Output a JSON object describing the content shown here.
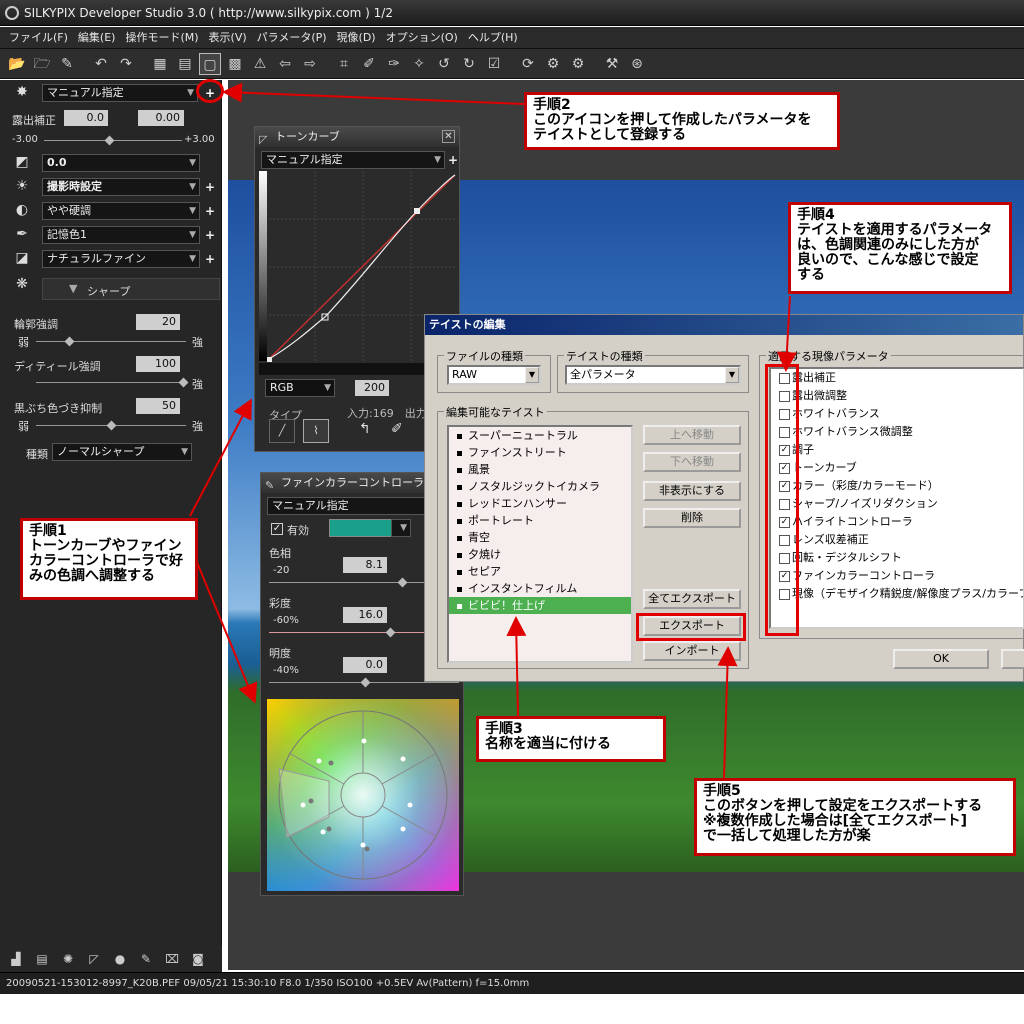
{
  "window": {
    "title": "SILKYPIX Developer Studio 3.0 ( http://www.silkypix.com )  1/2"
  },
  "menu": [
    "ファイル(F)",
    "編集(E)",
    "操作モード(M)",
    "表示(V)",
    "パラメータ(P)",
    "現像(D)",
    "オプション(O)",
    "ヘルプ(H)"
  ],
  "left": {
    "taste_select": "マニュアル指定",
    "exposure_label": "露出補正",
    "exposure_value": "0.0",
    "exposure_value2": "0.00",
    "exposure_min": "-3.00",
    "exposure_max": "+3.00",
    "wb_value": "0.0",
    "wb_mode": "撮影時設定",
    "contrast": "やや硬調",
    "color": "記憶色1",
    "finish": "ナチュラルファイン",
    "sharp_title": "シャープ",
    "sharp_rows": [
      {
        "label": "輪郭強調",
        "value": "20"
      },
      {
        "label": "ディティール強調",
        "value": "100"
      },
      {
        "label": "黒ぶち色づき抑制",
        "value": "50"
      }
    ],
    "weak": "弱",
    "strong": "強",
    "type_label": "種類",
    "type_value": "ノーマルシャープ"
  },
  "tone": {
    "title": "トーンカーブ",
    "mode": "マニュアル指定",
    "channel": "RGB",
    "input_value": "200",
    "type_label": "タイプ",
    "io_text": "入力:169　出力"
  },
  "fcc": {
    "title": "ファインカラーコントローラ",
    "mode": "マニュアル指定",
    "enabled": "有効",
    "hue_label": "色相",
    "hue_min": "-20",
    "hue_value": "8.1",
    "sat_label": "彩度",
    "sat_min": "-60%",
    "sat_value": "16.0",
    "bri_label": "明度",
    "bri_min": "-40%",
    "bri_value": "0.0"
  },
  "dialog": {
    "title": "テイストの編集",
    "file_type_label": "ファイルの種類",
    "file_type": "RAW",
    "taste_type_label": "テイストの種類",
    "taste_type": "全パラメータ",
    "editable_label": "編集可能なテイスト",
    "tastes": [
      "スーパーニュートラル",
      "ファインストリート",
      "風景",
      "ノスタルジックトイカメラ",
      "レッドエンハンサー",
      "ポートレート",
      "青空",
      "夕焼け",
      "セピア",
      "インスタントフィルム",
      "ビビビ！仕上げ"
    ],
    "btn_up": "上へ移動",
    "btn_down": "下へ移動",
    "btn_hide": "非表示にする",
    "btn_delete": "削除",
    "btn_export_all": "全てエクスポート",
    "btn_export": "エクスポート",
    "btn_import": "インポート",
    "params_label": "適用する現像パラメータ",
    "params": [
      {
        "label": "露出補正",
        "checked": false
      },
      {
        "label": "露出微調整",
        "checked": false
      },
      {
        "label": "ホワイトバランス",
        "checked": false
      },
      {
        "label": "ホワイトバランス微調整",
        "checked": false
      },
      {
        "label": "調子",
        "checked": true
      },
      {
        "label": "トーンカーブ",
        "checked": true
      },
      {
        "label": "カラー（彩度/カラーモード）",
        "checked": true
      },
      {
        "label": "シャープ/ノイズリダクション",
        "checked": false
      },
      {
        "label": "ハイライトコントローラ",
        "checked": true
      },
      {
        "label": "レンズ収差補正",
        "checked": false
      },
      {
        "label": "回転・デジタルシフト",
        "checked": false
      },
      {
        "label": "ファインカラーコントローラ",
        "checked": true
      },
      {
        "label": "現像（デモザイク精鋭度/解像度プラス/カラーフ",
        "checked": false
      }
    ],
    "ok": "OK"
  },
  "callouts": {
    "step1": "手順1\nトーンカーブやファイン\nカラーコントローラで好\nみの色調へ調整する",
    "step2": "手順2\nこのアイコンを押して作成したパラメータを\nテイストとして登録する",
    "step3": "手順3\n名称を適当に付ける",
    "step4": "手順4\nテイストを適用するパラメータ\nは、色調関連のみにした方が\n良いので、こんな感じで設定\nする",
    "step5": "手順5\nこのボタンを押して設定をエクスポートする\n※複数作成した場合は[全てエクスポート]\nで一括して処理した方が楽"
  },
  "status": "20090521-153012-8997_K20B.PEF 09/05/21 15:30:10 F8.0 1/350 ISO100 +0.5EV Av(Pattern) f=15.0mm"
}
